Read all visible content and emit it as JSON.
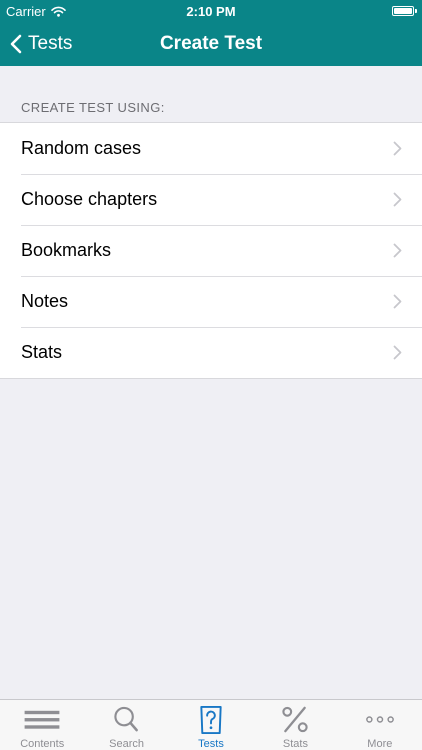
{
  "status_bar": {
    "carrier": "Carrier",
    "time": "2:10 PM"
  },
  "nav_bar": {
    "back_label": "Tests",
    "title": "Create Test"
  },
  "section": {
    "header": "CREATE TEST USING:",
    "items": [
      {
        "label": "Random cases"
      },
      {
        "label": "Choose chapters"
      },
      {
        "label": "Bookmarks"
      },
      {
        "label": "Notes"
      },
      {
        "label": "Stats"
      }
    ]
  },
  "tab_bar": {
    "active": "Tests",
    "tabs": [
      {
        "label": "Contents",
        "icon": "list-icon"
      },
      {
        "label": "Search",
        "icon": "search-icon"
      },
      {
        "label": "Tests",
        "icon": "question-document-icon"
      },
      {
        "label": "Stats",
        "icon": "percent-icon"
      },
      {
        "label": "More",
        "icon": "more-icon"
      }
    ]
  },
  "colors": {
    "nav_background": "#0a8588",
    "page_background": "#efeff4",
    "tab_active": "#1877c5",
    "tab_inactive": "#8e8e93"
  }
}
